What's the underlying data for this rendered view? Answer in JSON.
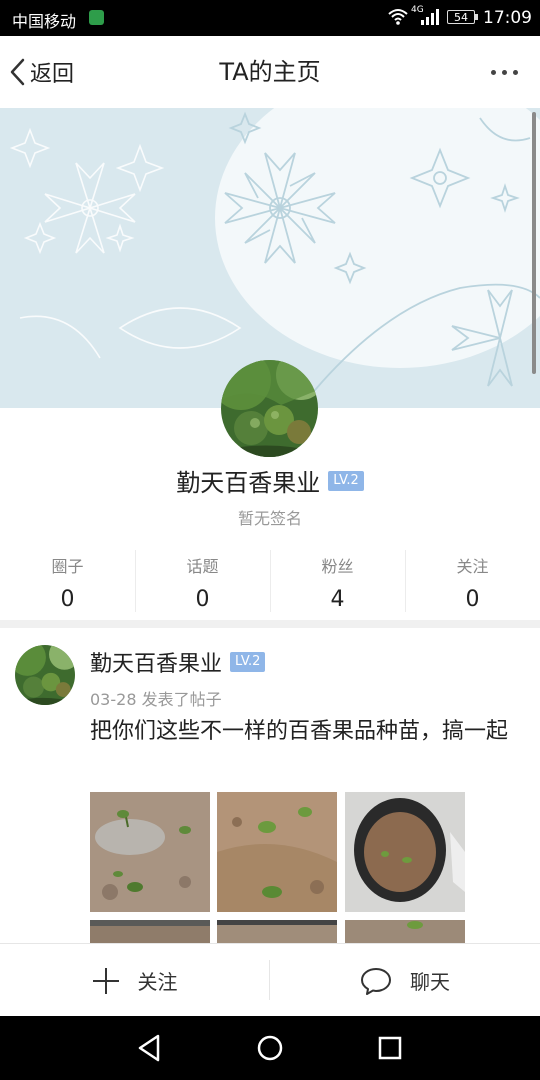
{
  "status_bar": {
    "carrier": "中国移动",
    "network": "4G",
    "battery": "54",
    "time": "17:09"
  },
  "header": {
    "back_label": "返回",
    "title": "TA的主页",
    "more_icon": "more-dots-icon"
  },
  "profile": {
    "name": "勤天百香果业",
    "level": "LV.2",
    "signature": "暂无签名",
    "stats": [
      {
        "label": "圈子",
        "value": "0"
      },
      {
        "label": "话题",
        "value": "0"
      },
      {
        "label": "粉丝",
        "value": "4"
      },
      {
        "label": "关注",
        "value": "0"
      }
    ]
  },
  "post": {
    "author": "勤天百香果业",
    "level": "LV.2",
    "date": "03-28",
    "action": "发表了帖子",
    "text": "把你们这些不一样的百香果品种苗，搞一起"
  },
  "action_bar": {
    "follow_label": "关注",
    "chat_label": "聊天"
  },
  "colors": {
    "level_badge": "#8fb6e8",
    "banner": "#d9e8ee",
    "status_bar": "#000000"
  }
}
